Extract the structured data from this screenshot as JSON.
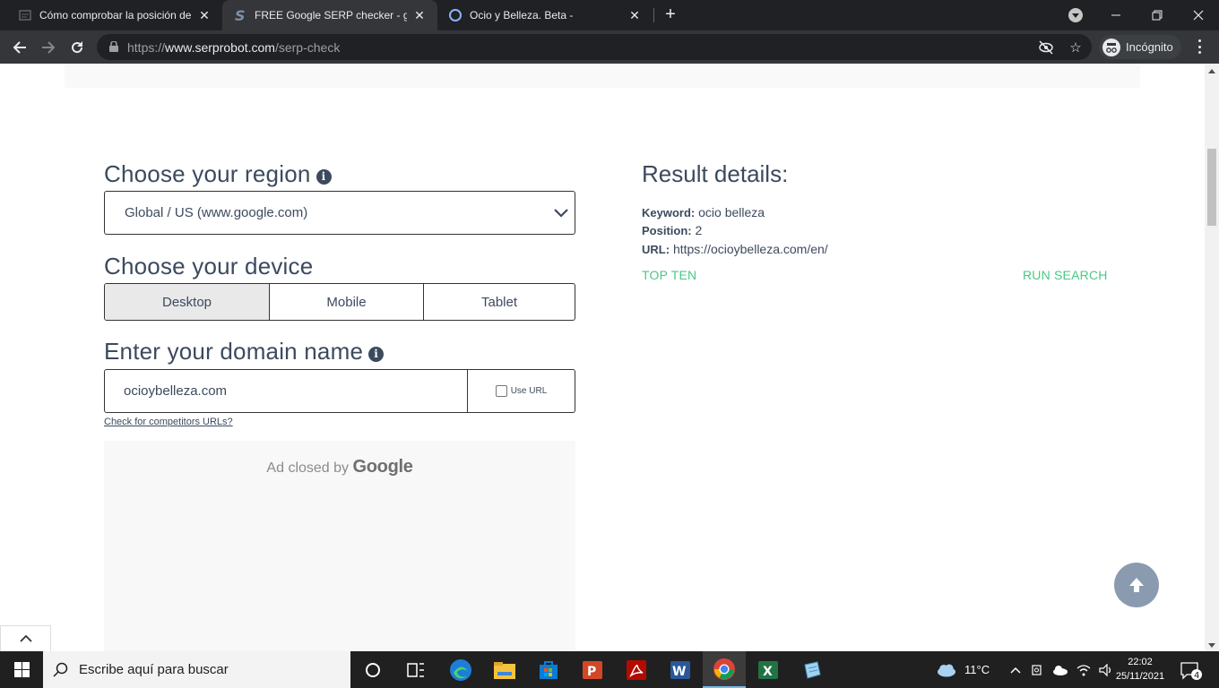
{
  "browser": {
    "tabs": [
      {
        "title": "Cómo comprobar la posición de",
        "active": false
      },
      {
        "title": "FREE Google SERP checker - goo",
        "active": true
      },
      {
        "title": "Ocio y Belleza. Beta -",
        "active": false
      }
    ],
    "url_scheme": "https://",
    "url_host": "www.serprobot.com",
    "url_path": "/serp-check",
    "profile_label": "Incógnito"
  },
  "page": {
    "region": {
      "heading": "Choose your region",
      "selected": "Global / US (www.google.com)"
    },
    "device": {
      "heading": "Choose your device",
      "options": [
        "Desktop",
        "Mobile",
        "Tablet"
      ],
      "selected": "Desktop"
    },
    "domain": {
      "heading": "Enter your domain name",
      "value": "ocioybelleza.com",
      "use_url_label": "Use URL",
      "competitors_link": "Check for competitors URLs?"
    },
    "ad": {
      "closed_text": "Ad closed by",
      "brand": "Google"
    },
    "result": {
      "heading": "Result details:",
      "keyword_label": "Keyword:",
      "keyword_value": "ocio belleza",
      "position_label": "Position:",
      "position_value": "2",
      "url_label": "URL:",
      "url_value": "https://ocioybelleza.com/en/",
      "top_ten_link": "TOP TEN",
      "run_search_link": "RUN SEARCH"
    }
  },
  "taskbar": {
    "search_placeholder": "Escribe aquí para buscar",
    "weather": "11°C",
    "time": "22:02",
    "date": "25/11/2021",
    "notification_count": "4"
  }
}
